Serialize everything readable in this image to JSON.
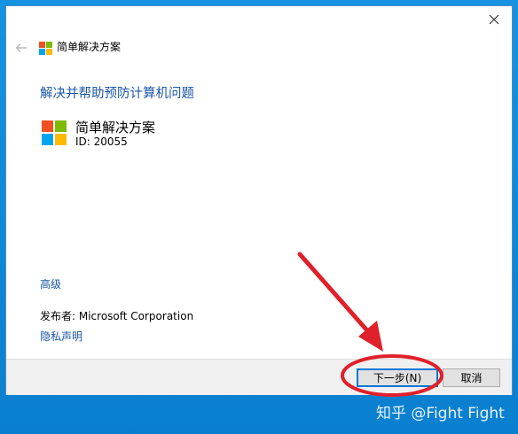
{
  "window": {
    "close_icon": "close-icon"
  },
  "header": {
    "back_icon": "back-arrow-icon",
    "logo_icon": "windows-logo-icon",
    "title": "简单解决方案"
  },
  "main": {
    "heading": "解决并帮助预防计算机问题",
    "package": {
      "logo_icon": "windows-logo-icon",
      "name": "简单解决方案",
      "id": "ID: 20055"
    },
    "advanced_link": "高级",
    "publisher": "发布者:  Microsoft Corporation",
    "privacy_link": "隐私声明"
  },
  "footer": {
    "next_label": "下一步(N)",
    "cancel_label": "取消"
  },
  "annotation": {
    "color": "#e0202a"
  },
  "watermark": "知乎 @Fight Fight",
  "colors": {
    "desktop": "#0e86d4",
    "link": "#1a56a6",
    "logo_red": "#f25022",
    "logo_green": "#7fba00",
    "logo_blue": "#00a4ef",
    "logo_yellow": "#ffb900"
  }
}
